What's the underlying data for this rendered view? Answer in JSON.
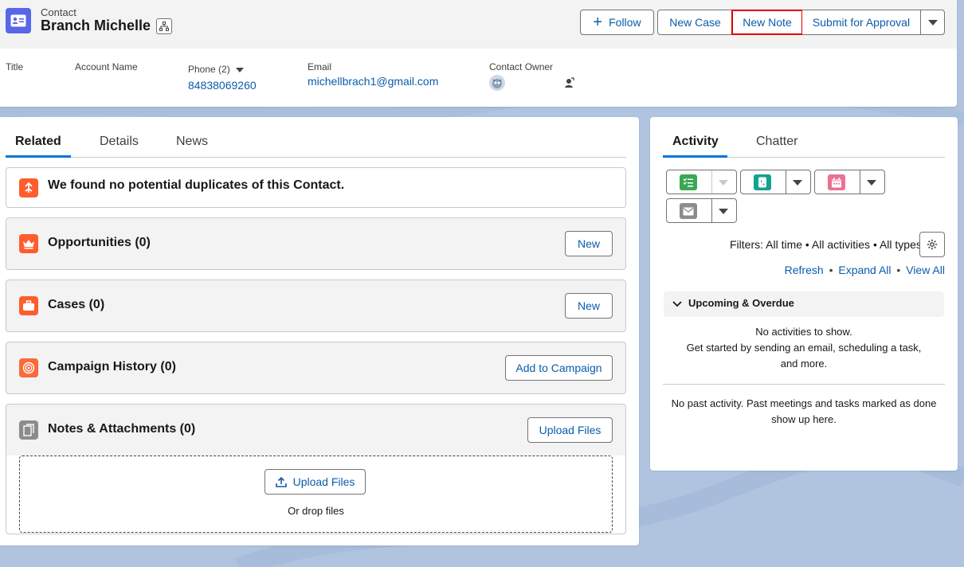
{
  "header": {
    "object_type": "Contact",
    "record_name": "Branch Michelle",
    "actions": {
      "follow": "Follow",
      "new_case": "New Case",
      "new_note": "New Note",
      "submit_for_approval": "Submit for Approval"
    },
    "fields": {
      "title_label": "Title",
      "account_label": "Account Name",
      "phone_label": "Phone (2)",
      "phone_value": "84838069260",
      "email_label": "Email",
      "email_value": "michellbrach1@gmail.com",
      "owner_label": "Contact Owner"
    }
  },
  "left": {
    "tabs": [
      "Related",
      "Details",
      "News"
    ],
    "duplicates_text": "We found no potential duplicates of this Contact.",
    "sections": {
      "opportunities": {
        "title": "Opportunities (0)",
        "button": "New"
      },
      "cases": {
        "title": "Cases (0)",
        "button": "New"
      },
      "campaign": {
        "title": "Campaign History (0)",
        "button": "Add to Campaign"
      },
      "notes": {
        "title": "Notes & Attachments (0)",
        "button": "Upload Files"
      }
    },
    "dropzone": {
      "upload_label": "Upload Files",
      "drop_text": "Or drop files"
    }
  },
  "right": {
    "tabs": [
      "Activity",
      "Chatter"
    ],
    "filters_text": "Filters: All time • All activities • All types",
    "links": {
      "refresh": "Refresh",
      "expand_all": "Expand All",
      "view_all": "View All",
      "sep": "•"
    },
    "upcoming": {
      "title": "Upcoming & Overdue",
      "empty1": "No activities to show.",
      "empty2": "Get started by sending an email, scheduling a task, and more."
    },
    "past": "No past activity. Past meetings and tasks marked as done show up here."
  },
  "colors": {
    "accent": "#0176d3",
    "link": "#0b5cab",
    "contact_icon": "#5867e8",
    "highlight_border": "#e00000",
    "opportunity_icon": "#ff5d2d",
    "case_icon": "#ff5d2d",
    "campaign_icon": "#f86b3b",
    "notes_icon": "#8c8c8c",
    "task_icon": "#3ba755",
    "call_icon": "#12a290",
    "event_icon": "#eb7092",
    "email_icon": "#8c8c8c"
  }
}
